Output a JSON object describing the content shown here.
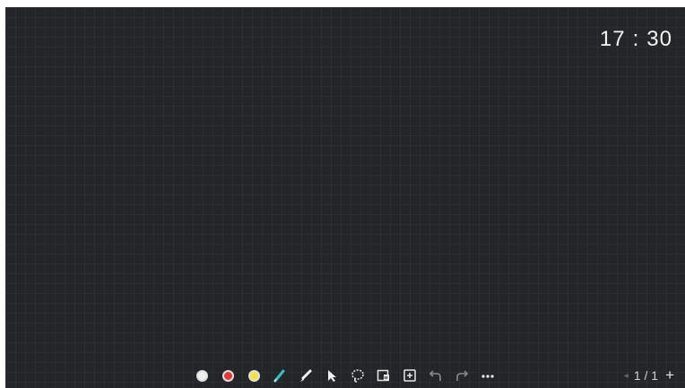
{
  "clock": {
    "hours": "17",
    "separator": ":",
    "minutes": "30"
  },
  "toolbar": {
    "colors": [
      "#f0f0f0",
      "#e53935",
      "#f4e13b"
    ],
    "accent_pen": "#2ec7c0",
    "icons": [
      "white-color-icon",
      "red-color-icon",
      "yellow-color-icon",
      "pen-icon",
      "brush-icon",
      "select-arrow-icon",
      "lasso-icon",
      "clear-page-icon",
      "insert-icon",
      "undo-icon",
      "redo-icon",
      "more-icon"
    ]
  },
  "pager": {
    "prev": "◂",
    "page_text": "1 / 1",
    "add": "+"
  }
}
